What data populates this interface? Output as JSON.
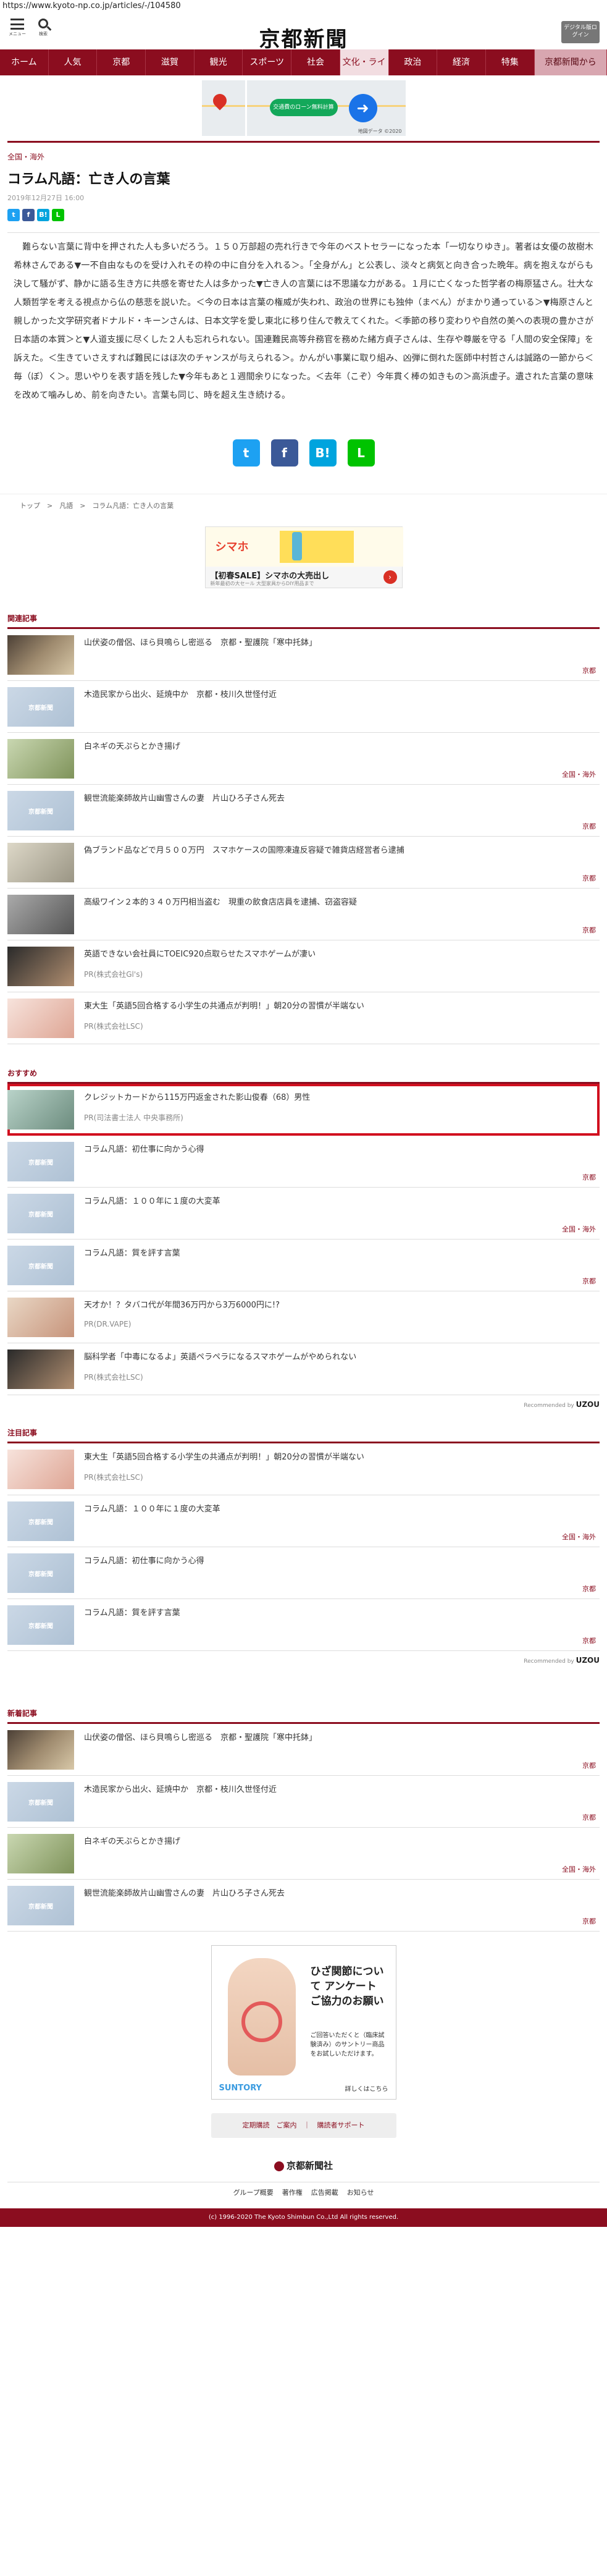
{
  "url": "https://www.kyoto-np.co.jp/articles/-/104580",
  "header": {
    "menu_label": "メニュー",
    "search_label": "検索",
    "logo": "京都新聞",
    "digital_button": "デジタル版ログイン"
  },
  "nav": [
    "ホーム",
    "人気",
    "京都",
    "滋賀",
    "観光",
    "スポーツ",
    "社会",
    "文化・ライフ",
    "政治",
    "経済",
    "特集",
    "京都新聞から"
  ],
  "nav_current": "文化・ライフ",
  "ad_top": {
    "pill": "交通費のローン無料計算",
    "caption": "地図データ ©2020"
  },
  "article": {
    "category": "全国・海外",
    "title": "コラム凡語：亡き人の言葉",
    "date": "2019年12月27日 16:00",
    "body": "　難らない言葉に背中を押された人も多いだろう。１５０万部超の売れ行きで今年のベストセラーになった本「一切なりゆき」。著者は女優の故樹木希林さんである▼一不自由なものを受け入れその枠の中に自分を入れる＞。「全身がん」と公表し、淡々と病気と向き合った晩年。病を抱えながらも決して騒がず、静かに語る生き方に共感を寄せた人は多かった▼亡き人の言葉には不思議な力がある。１月に亡くなった哲学者の梅原猛さん。壮大な人類哲学を考える視点から仏の慈悲を説いた。＜今の日本は言葉の権威が失われ、政治の世界にも独仲（まべん）がまかり通っている＞▼梅原さんと親しかった文学研究者ドナルド・キーンさんは、日本文学を愛し東北に移り住んで教えてくれた。＜季節の移り変わりや自然の美への表現の豊かさが日本語の本質＞と▼人道支援に尽くした２人も忘れられない。国連難民高等弁務官を務めた緒方貞子さんは、生存や尊厳を守る「人間の安全保障」を訴えた。＜生きていさえすれば難民にはほ次のチャンスが与えられる＞。かんがい事業に取り組み、凶弾に倒れた医師中村哲さんは誠路の一節から＜毎（ぼ）く＞。思いやりを表す語を残した▼今年もあと１週間余りになった。＜去年（こぞ）今年貫く棒の如きもの＞高浜虚子。遺された言葉の意味を改めて噛みしめ、前を向きたい。言葉も同じ、時を超え生き続ける。"
  },
  "breadcrumb": [
    "トップ",
    "凡語",
    "コラム凡語：亡き人の言葉"
  ],
  "ad_mid": {
    "brand": "シマホ",
    "title": "【初春SALE】シマホの大売出し",
    "sub": "新年最初の大セール 大型家具からDIY用品まで"
  },
  "related": {
    "heading": "関連記事",
    "items": [
      {
        "title": "山伏姿の僧侶、ほら貝鳴らし密巡る　京都・聖護院「寒中托鉢」",
        "label": "京都"
      },
      {
        "title": "木造民家から出火、延焼中か　京都・枝川久世怪付近",
        "label": ""
      },
      {
        "title": "白ネギの天ぷらとかき揚げ",
        "label": "全国・海外"
      },
      {
        "title": "観世流能楽師故片山幽雪さんの妻　片山ひろ子さん死去",
        "label": "京都"
      },
      {
        "title": "偽ブランド品などで月５００万円　スマホケースの国際凍違反容疑で雑貨店経営者ら逮捕",
        "label": "京都"
      },
      {
        "title": "高級ワイン２本的３４０万円相当盗む　現重の飲食店店員を逮捕、窃盗容疑",
        "label": "京都"
      },
      {
        "title": "英語できない会社員にTOEIC920点取らせたスマホゲームが凄い",
        "label": "",
        "pr": "PR(株式会社Gl's)"
      },
      {
        "title": "東大生「英語5回合格する小学生の共通点が判明！」朝20分の習慣が半端ない",
        "label": "",
        "pr": "PR(株式会社LSC)"
      }
    ]
  },
  "recommend": {
    "heading": "おすすめ",
    "items": [
      {
        "title": "クレジットカードから115万円返金された影山俊春（68）男性",
        "label": "",
        "pr": "PR(司法書士法人 中央事務所)"
      },
      {
        "title": "コラム凡語：初仕事に向かう心得",
        "label": "京都"
      },
      {
        "title": "コラム凡語：１００年に１度の大変革",
        "label": "全国・海外"
      },
      {
        "title": "コラム凡語：質を評す言葉",
        "label": "京都"
      },
      {
        "title": "天才か！？タバコ代が年間36万円から3万6000円に!?",
        "label": "",
        "pr": "PR(DR.VAPE)"
      },
      {
        "title": "脳科学者「中毒になるよ」英語ペラペラになるスマホゲームがやめられない",
        "label": "",
        "pr": "PR(株式会社LSC)"
      }
    ],
    "credit_pre": "Recommended by",
    "credit": "UZOU"
  },
  "attention": {
    "heading": "注目記事",
    "items": [
      {
        "title": "東大生「英語5回合格する小学生の共通点が判明！」朝20分の習慣が半端ない",
        "label": "",
        "pr": "PR(株式会社LSC)"
      },
      {
        "title": "コラム凡語：１００年に１度の大変革",
        "label": "全国・海外"
      },
      {
        "title": "コラム凡語：初仕事に向かう心得",
        "label": "京都"
      },
      {
        "title": "コラム凡語：質を評す言葉",
        "label": "京都"
      }
    ],
    "credit_pre": "Recommended by",
    "credit": "UZOU"
  },
  "latest": {
    "heading": "新着記事",
    "items": [
      {
        "title": "山伏姿の僧侶、ほら貝鳴らし密巡る　京都・聖護院「寒中托鉢」",
        "label": "京都"
      },
      {
        "title": "木造民家から出火、延焼中か　京都・枝川久世怪付近",
        "label": "京都"
      },
      {
        "title": "白ネギの天ぷらとかき揚げ",
        "label": "全国・海外"
      },
      {
        "title": "観世流能楽師故片山幽雪さんの妻　片山ひろ子さん死去",
        "label": "京都"
      }
    ]
  },
  "ad_bottom": {
    "title": "ひざ関節について アンケート ご協力のお願い",
    "sub": "ご回答いただくと（臨床試験済み）のサントリー商品をお試しいただけます。",
    "brand": "SUNTORY",
    "more": "詳しくはこちら"
  },
  "footer": {
    "button": "定期購読　ご案内　｜　購読者サポート",
    "logo": "京都新聞社",
    "links": [
      "グループ概要",
      "著作権",
      "広告掲載",
      "お知らせ"
    ],
    "copyright": "(c) 1996-2020 The Kyoto Shimbun Co.,Ltd All rights reserved."
  }
}
